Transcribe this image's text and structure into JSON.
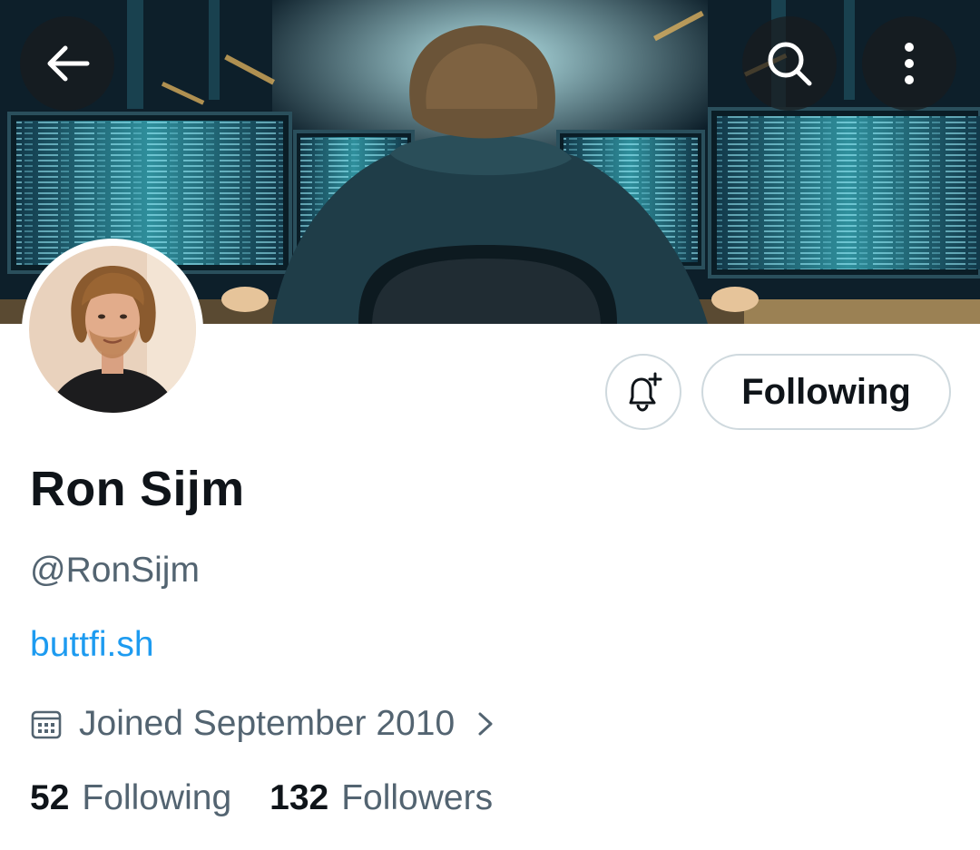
{
  "profile": {
    "display_name": "Ron Sijm",
    "handle": "@RonSijm",
    "website": "buttfi.sh",
    "joined": "Joined September 2010"
  },
  "actions": {
    "follow_label": "Following"
  },
  "stats": {
    "following_count": "52",
    "following_label": "Following",
    "followers_count": "132",
    "followers_label": "Followers"
  },
  "icons": {
    "back": "arrow-left-icon",
    "search": "search-icon",
    "more": "more-vertical-icon",
    "notify": "bell-plus-icon",
    "calendar": "calendar-icon",
    "chevron": "chevron-right-icon"
  },
  "colors": {
    "link": "#1d9bf0",
    "secondary_text": "#536471",
    "primary_text": "#0f1419",
    "border": "#cfd9de"
  }
}
